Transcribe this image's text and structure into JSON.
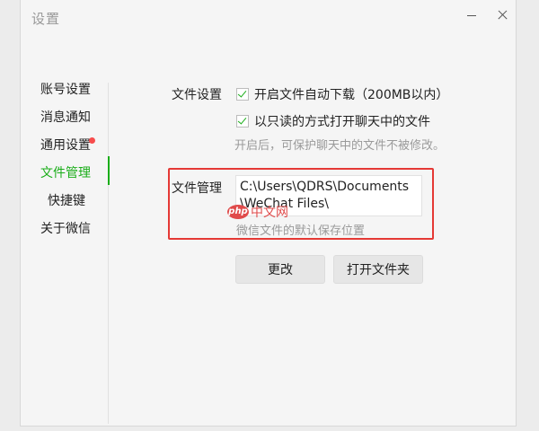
{
  "window": {
    "title": "设置"
  },
  "sidebar": {
    "items": [
      {
        "label": "账号设置"
      },
      {
        "label": "消息通知"
      },
      {
        "label": "通用设置"
      },
      {
        "label": "文件管理"
      },
      {
        "label": "快捷键"
      },
      {
        "label": "关于微信"
      }
    ]
  },
  "file_settings": {
    "section_label": "文件设置",
    "auto_download": {
      "label": "开启文件自动下载（200MB以内）",
      "checked": true
    },
    "read_only_open": {
      "label": "以只读的方式打开聊天中的文件",
      "checked": true
    },
    "hint": "开启后，可保护聊天中的文件不被修改。"
  },
  "file_management": {
    "section_label": "文件管理",
    "path": "C:\\Users\\QDRS\\Documents\\WeChat Files\\",
    "hint": "微信文件的默认保存位置",
    "change_button": "更改",
    "open_folder_button": "打开文件夹"
  },
  "watermark": {
    "logo": "php",
    "text": "中文网"
  },
  "colors": {
    "accent": "#1aad19",
    "badge": "#f74c4c",
    "highlight": "#e53935"
  }
}
